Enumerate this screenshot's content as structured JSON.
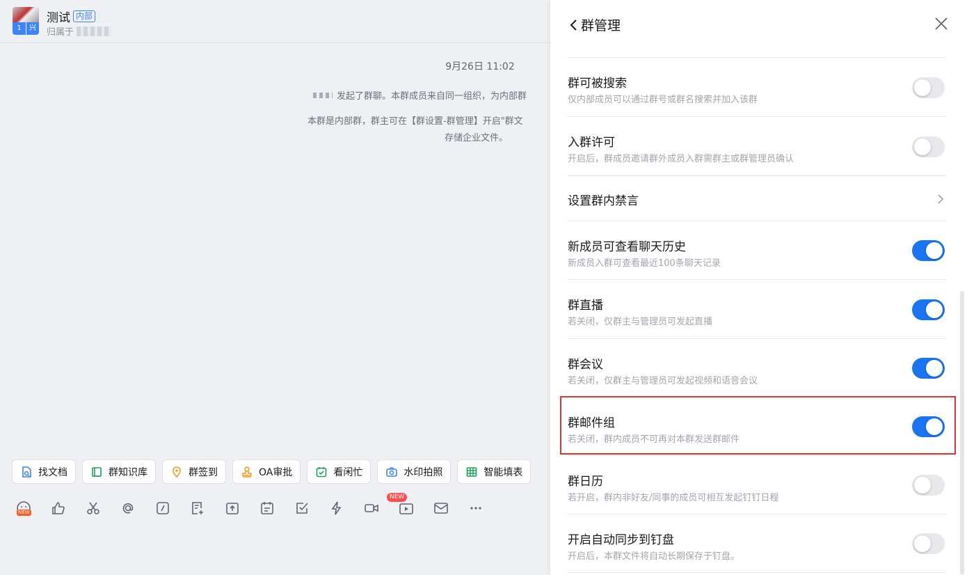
{
  "chat": {
    "title": "测试",
    "badge": "内部",
    "subtitle": "归属于",
    "avatar_tags": [
      "1",
      "兴"
    ],
    "timestamp": "9月26日 11:02",
    "system_messages": [
      "发起了群聊。本群成员来自同一组织，为内部群",
      "本群是内部群，群主可在【群设置-群管理】开启\"群文",
      "存储企业文件。"
    ],
    "quick_actions": [
      {
        "label": "找文档",
        "icon": "doc-search-icon",
        "color": "#3d84f7"
      },
      {
        "label": "群知识库",
        "icon": "knowledge-base-icon",
        "color": "#1aa35b"
      },
      {
        "label": "群签到",
        "icon": "location-pin-icon",
        "color": "#f59a23"
      },
      {
        "label": "OA审批",
        "icon": "approval-stamp-icon",
        "color": "#f59a23"
      },
      {
        "label": "看闲忙",
        "icon": "calendar-check-icon",
        "color": "#1aa35b"
      },
      {
        "label": "水印拍照",
        "icon": "camera-icon",
        "color": "#3d84f7"
      },
      {
        "label": "智能填表",
        "icon": "table-grid-icon",
        "color": "#1aa35b"
      }
    ],
    "toolbar_new_tag": "NEW",
    "toolbar_new_tag_small": "NEW",
    "toolbar_icons": [
      "emoji-icon",
      "thumbs-up-icon",
      "scissors-icon",
      "at-icon",
      "slash-command-icon",
      "doc-add-icon",
      "upload-folder-icon",
      "calendar-icon",
      "todo-check-icon",
      "lightning-icon",
      "video-call-icon",
      "live-broadcast-icon",
      "mail-icon",
      "more-icon"
    ]
  },
  "panel": {
    "title": "群管理",
    "settings": [
      {
        "title": "群可被搜索",
        "desc": "仅内部成员可以通过群号或群名搜索并加入该群",
        "type": "toggle",
        "on": false
      },
      {
        "title": "入群许可",
        "desc": "开启后，群成员邀请群外成员入群需群主或群管理员确认",
        "type": "toggle",
        "on": false
      },
      {
        "title": "设置群内禁言",
        "desc": "",
        "type": "link",
        "on": false
      },
      {
        "title": "新成员可查看聊天历史",
        "desc": "新成员入群可查看最近100条聊天记录",
        "type": "toggle",
        "on": true
      },
      {
        "title": "群直播",
        "desc": "若关闭，仅群主与管理员可发起直播",
        "type": "toggle",
        "on": true
      },
      {
        "title": "群会议",
        "desc": "若关闭，仅群主与管理员可发起视频和语音会议",
        "type": "toggle",
        "on": true
      },
      {
        "title": "群邮件组",
        "desc": "若关闭，群内成员不可再对本群发送群邮件",
        "type": "toggle",
        "on": true
      },
      {
        "title": "群日历",
        "desc": "若开启，群内非好友/同事的成员可相互发起钉钉日程",
        "type": "toggle",
        "on": false
      },
      {
        "title": "开启自动同步到钉盘",
        "desc": "开启后，本群文件将自动长期保存于钉盘。",
        "type": "toggle",
        "on": false
      }
    ],
    "colors": {
      "toggle_on": "#1a74f0",
      "toggle_off": "#e6e8eb",
      "highlight": "#e03131"
    }
  }
}
